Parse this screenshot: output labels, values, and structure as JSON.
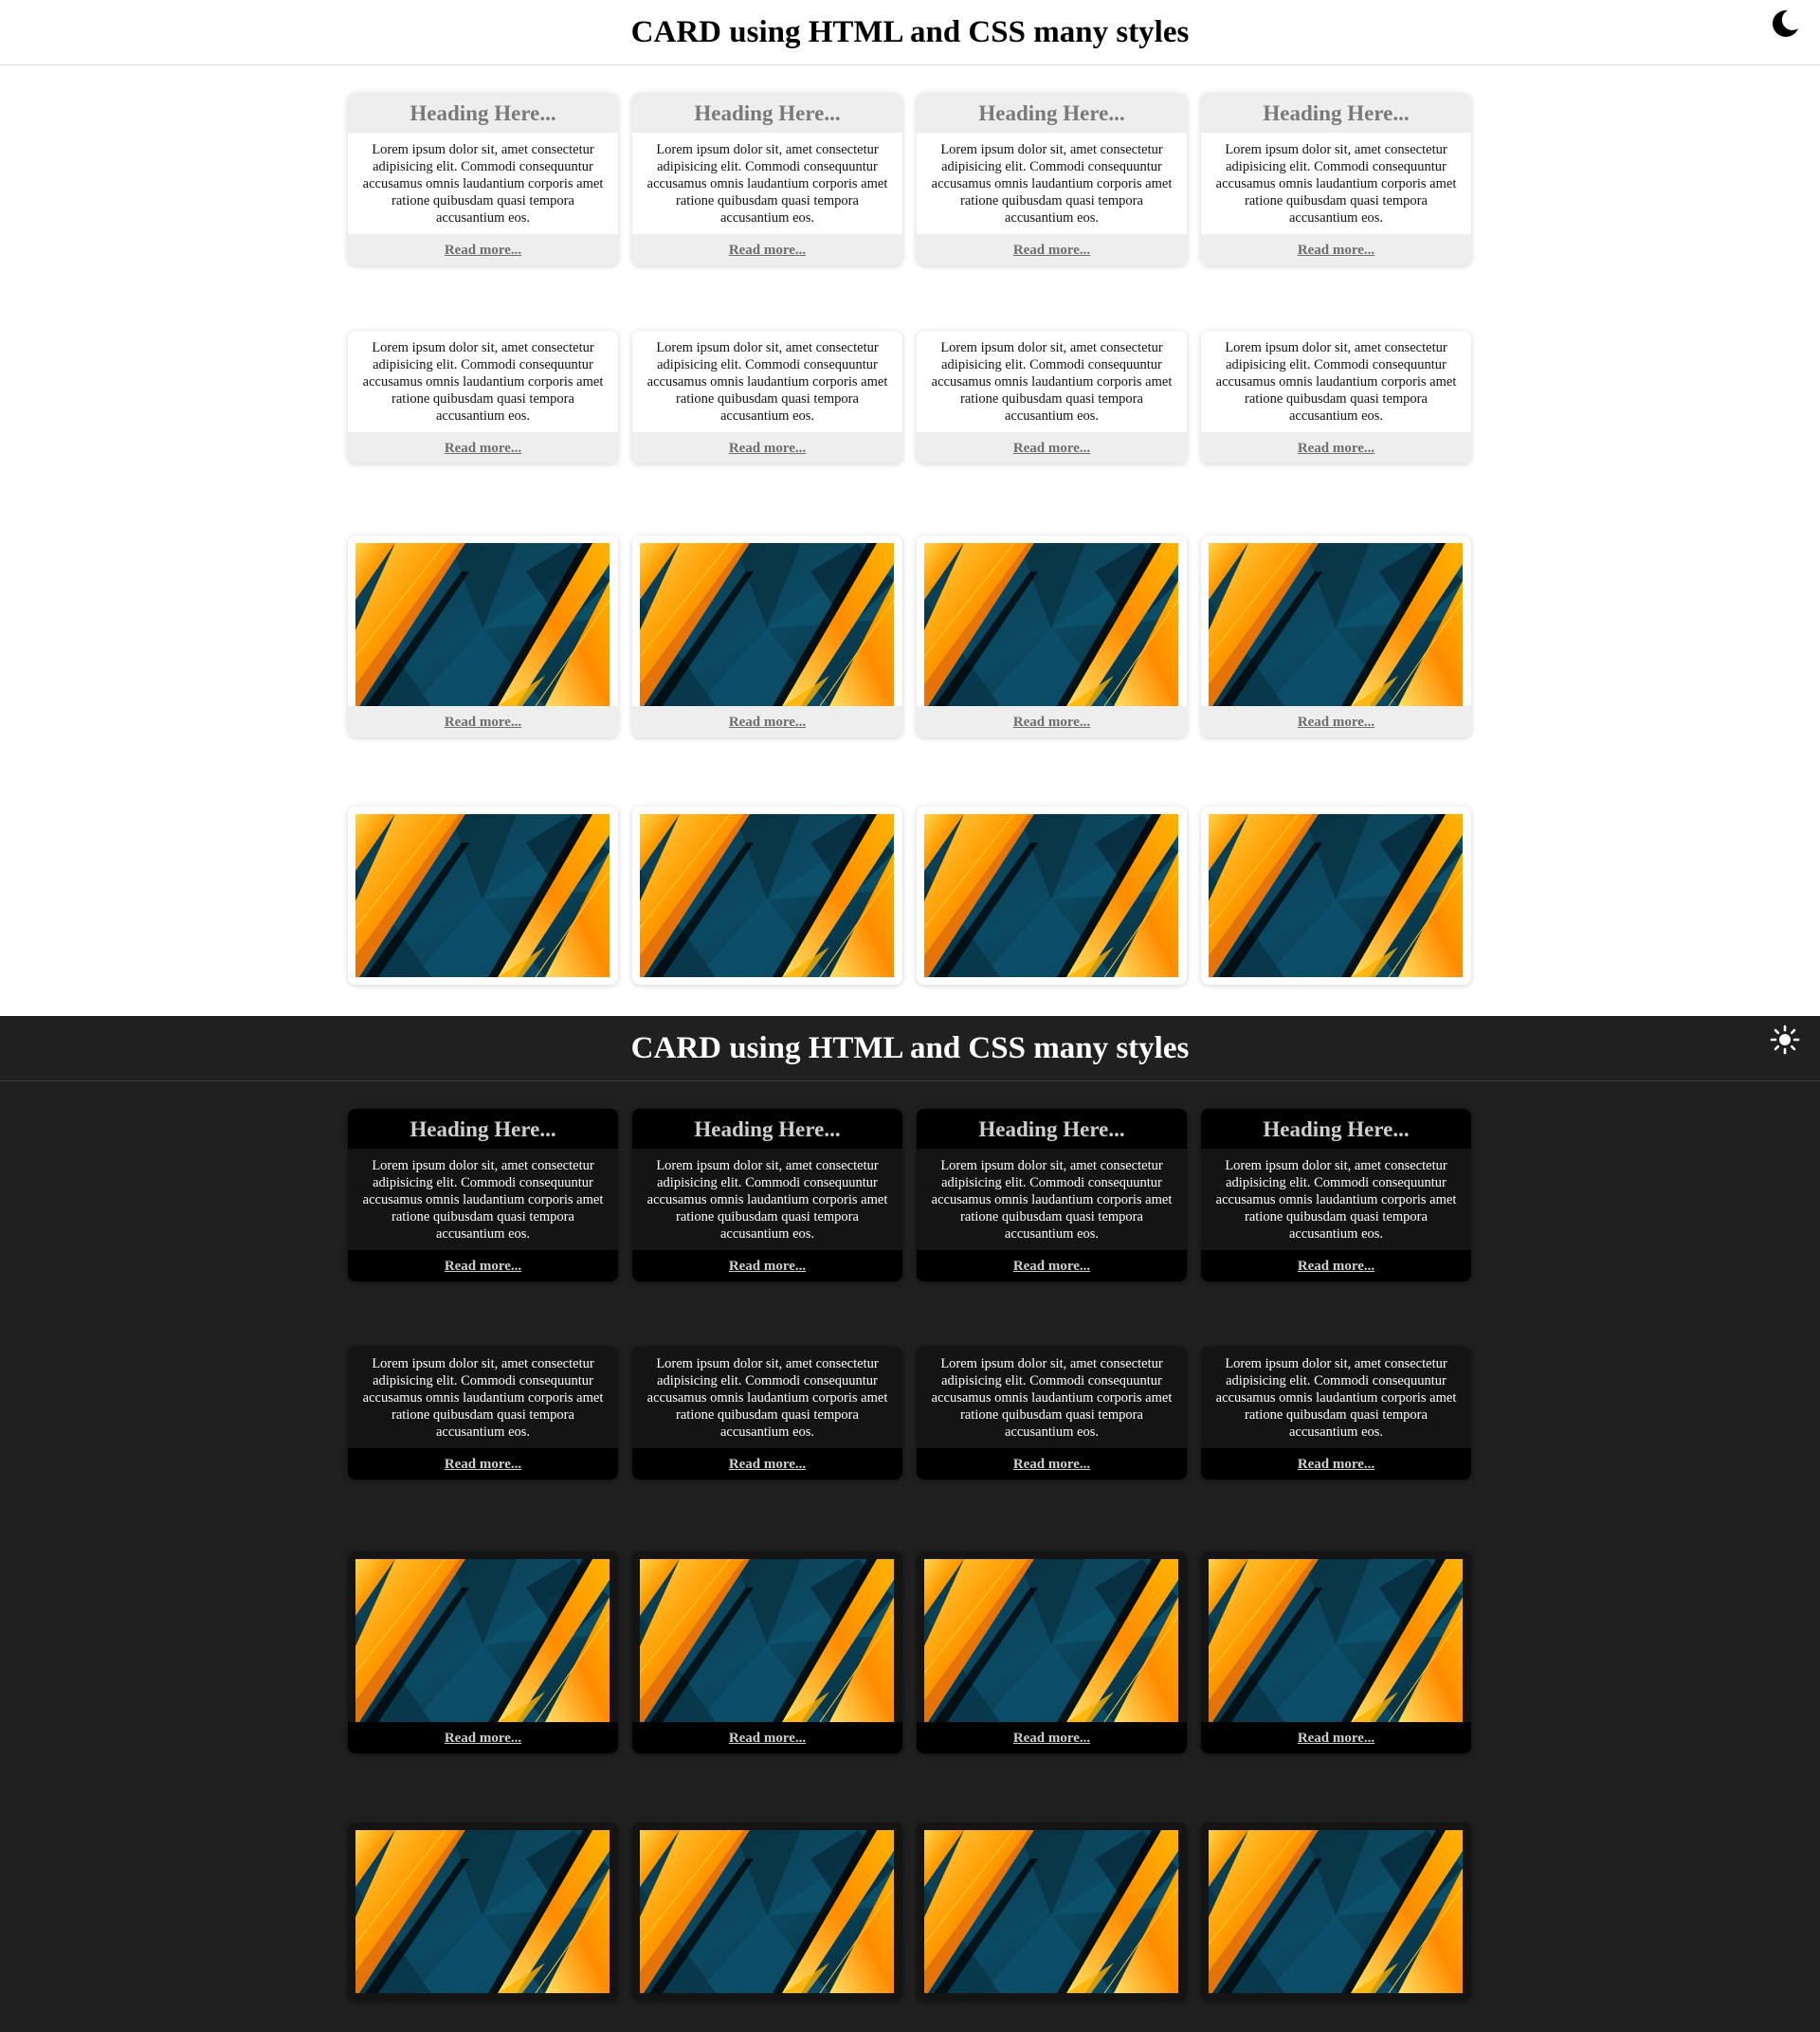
{
  "light": {
    "title": "CARD using HTML and CSS many styles",
    "theme_toggle_icon": "moon-icon"
  },
  "dark": {
    "title": "CARD using HTML and CSS many styles",
    "theme_toggle_icon": "sun-icon"
  },
  "card": {
    "heading": "Heading Here...",
    "body": "Lorem ipsum dolor sit, amet consectetur adipisicing elit. Commodi consequuntur accusamus omnis laudantium corporis amet ratione quibusdam quasi tempora accusantium eos.",
    "link": "Read more..."
  },
  "colors": {
    "light_bg": "#ffffff",
    "dark_bg": "#202020",
    "card_strip_light": "#eeeeee",
    "card_strip_dark": "#000000",
    "image_teal": "#0b4a63",
    "image_orange": "#ff9a00"
  }
}
